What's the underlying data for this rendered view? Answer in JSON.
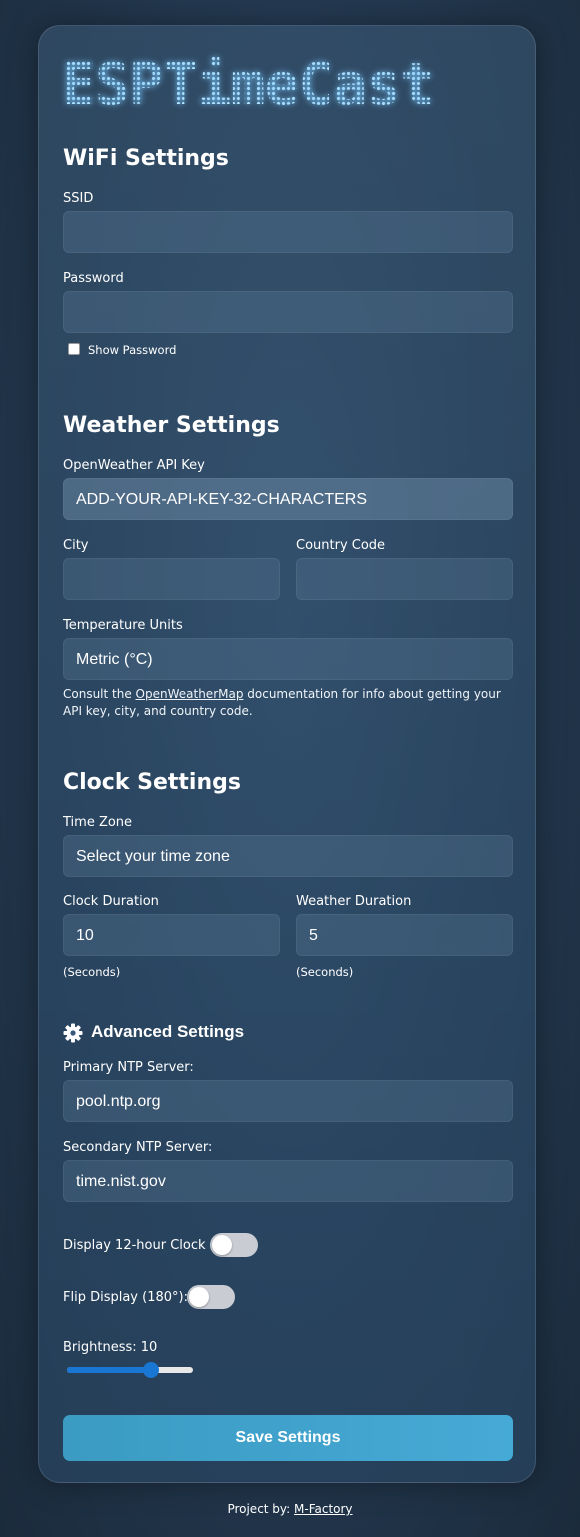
{
  "logo": {
    "text": "ESPTimeCast"
  },
  "wifi": {
    "title": "WiFi Settings",
    "ssid_label": "SSID",
    "ssid_value": "",
    "password_label": "Password",
    "password_value": "",
    "show_password_label": "Show Password"
  },
  "weather": {
    "title": "Weather Settings",
    "api_key_label": "OpenWeather API Key",
    "api_key_value": "ADD-YOUR-API-KEY-32-CHARACTERS",
    "city_label": "City",
    "city_value": "",
    "country_label": "Country Code",
    "country_value": "",
    "units_label": "Temperature Units",
    "units_value": "Metric (°C)",
    "note_prefix": "Consult the ",
    "note_link": "OpenWeatherMap",
    "note_suffix": " documentation for info about getting your API key, city, and country code."
  },
  "clock": {
    "title": "Clock Settings",
    "timezone_label": "Time Zone",
    "timezone_value": "Select your time zone",
    "clock_duration_label": "Clock Duration",
    "clock_duration_value": "10",
    "clock_duration_unit": "(Seconds)",
    "weather_duration_label": "Weather Duration",
    "weather_duration_value": "5",
    "weather_duration_unit": "(Seconds)"
  },
  "advanced": {
    "title": "Advanced Settings",
    "icon": "gear-icon",
    "primary_ntp_label": "Primary NTP Server:",
    "primary_ntp_value": "pool.ntp.org",
    "secondary_ntp_label": "Secondary NTP Server:",
    "secondary_ntp_value": "time.nist.gov",
    "twelve_hour_label": "Display 12-hour Clock",
    "twelve_hour_on": false,
    "flip_label": "Flip Display (180°):",
    "flip_on": false,
    "brightness_label": "Brightness: 10",
    "brightness_value": 10,
    "brightness_max": 15
  },
  "save_label": "Save Settings",
  "footer": {
    "prefix": "Project by: ",
    "link": "M-Factory"
  },
  "colors": {
    "accent": "#1976d2",
    "button": "#46aad6"
  }
}
